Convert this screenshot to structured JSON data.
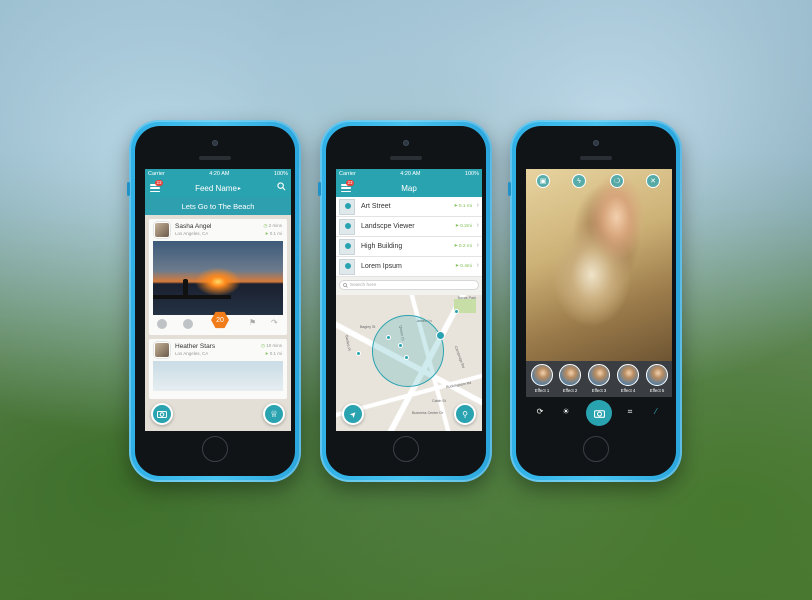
{
  "phone1": {
    "status": {
      "carrier": "Carrier",
      "time": "4:20 AM",
      "battery": "100%"
    },
    "nav": {
      "title": "Feed Name",
      "badge": "23"
    },
    "feed_title": "Lets Go to The Beach",
    "cards": [
      {
        "name": "Sasha Angel",
        "location": "Los Angeles, CA",
        "time": "2 mins",
        "distance": "0.1 mi",
        "likes": "20"
      },
      {
        "name": "Heather Stars",
        "location": "Los Angeles, CA",
        "time": "10 mins",
        "distance": "0.1 mi"
      }
    ]
  },
  "phone2": {
    "status": {
      "carrier": "Carrier",
      "time": "4:20 AM",
      "battery": "100%"
    },
    "nav": {
      "title": "Map",
      "badge": "23"
    },
    "places": [
      {
        "label": "Art Street",
        "distance": "0.1 mi"
      },
      {
        "label": "Landscpe Viewer",
        "distance": "0.2mi"
      },
      {
        "label": "High Building",
        "distance": "0.2 mi"
      },
      {
        "label": "Lorem Ipsum",
        "distance": "0.4mi"
      }
    ],
    "search_placeholder": "Search here",
    "streets": [
      "James Ln",
      "Cambridge Rd",
      "Bagley St",
      "Bartlett Pl",
      "Cabin St",
      "Queen Ct",
      "Bavas Park",
      "Buckingham Rd",
      "Business Center Dr"
    ]
  },
  "phone3": {
    "effects": [
      "Effect 1",
      "Effect 2",
      "Effect 3",
      "Effect 4",
      "Effect 5"
    ]
  },
  "colors": {
    "accent": "#2aa3b0",
    "badge": "#e5403a",
    "like_badge": "#f07d1a",
    "phone_body": "#3ab8ea"
  }
}
